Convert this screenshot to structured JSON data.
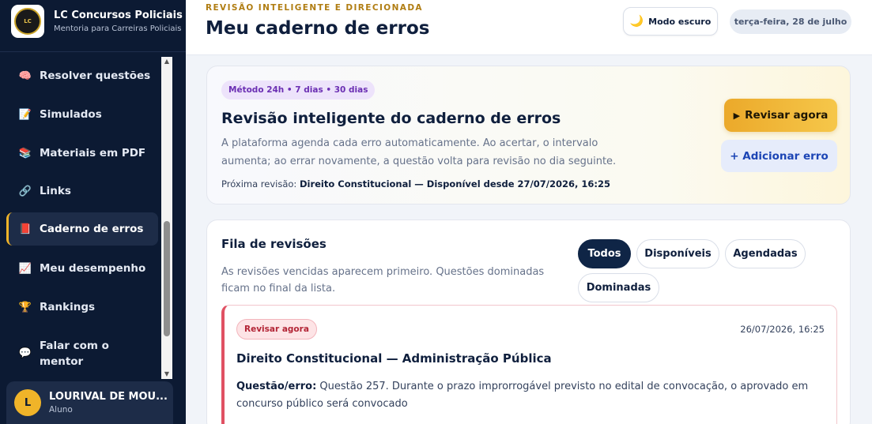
{
  "brand": {
    "logo_text": "LC",
    "title": "LC Concursos Policiais",
    "subtitle": "Mentoria para Carreiras Policiais"
  },
  "nav": {
    "items": [
      {
        "label": "Resolver questões",
        "icon": "brain-icon"
      },
      {
        "label": "Simulados",
        "icon": "memo-icon"
      },
      {
        "label": "Materiais em PDF",
        "icon": "books-icon"
      },
      {
        "label": "Links",
        "icon": "link-icon"
      },
      {
        "label": "Caderno de erros",
        "icon": "red-book-icon",
        "active": true
      },
      {
        "label": "Meu desempenho",
        "icon": "chart-icon"
      },
      {
        "label": "Rankings",
        "icon": "trophy-icon"
      },
      {
        "label": "Falar com o mentor",
        "icon": "chat-icon"
      }
    ]
  },
  "user": {
    "initial": "L",
    "name": "LOURIVAL DE MOU...",
    "role": "Aluno"
  },
  "header": {
    "eyebrow": "REVISÃO INTELIGENTE E DIRECIONADA",
    "title": "Meu caderno de erros",
    "dark_mode_label": "Modo escuro",
    "date": "terça-feira, 28 de julho"
  },
  "review": {
    "method_badge": "Método 24h • 7 dias • 30 dias",
    "title": "Revisão inteligente do caderno de erros",
    "description": "A plataforma agenda cada erro automaticamente. Ao acertar, o intervalo aumenta; ao errar novamente, a questão volta para revisão no dia seguinte.",
    "next_label": "Próxima revisão: ",
    "next_value": "Direito Constitucional — Disponível desde 27/07/2026, 16:25",
    "review_button": "Revisar agora",
    "add_button": "+ Adicionar erro"
  },
  "queue": {
    "title": "Fila de revisões",
    "description": "As revisões vencidas aparecem primeiro. Questões dominadas ficam no final da lista.",
    "filters": [
      "Todos",
      "Disponíveis",
      "Agendadas",
      "Dominadas"
    ],
    "active_filter": "Todos",
    "items": [
      {
        "status": "Revisar agora",
        "date": "26/07/2026, 16:25",
        "title": "Direito Constitucional — Administração Pública",
        "question_label": "Questão/erro:",
        "question_text": " Questão 257. Durante o prazo improrrogável previsto no edital de convocação, o aprovado em concurso público será convocado"
      }
    ]
  },
  "colors": {
    "sidebar_bg": "#0c1a33",
    "accent_gold": "#f0b429",
    "active_chip": "#0f2546",
    "danger": "#e05163",
    "purple_badge": "#6b2fb3",
    "link_blue": "#1c45b5"
  }
}
